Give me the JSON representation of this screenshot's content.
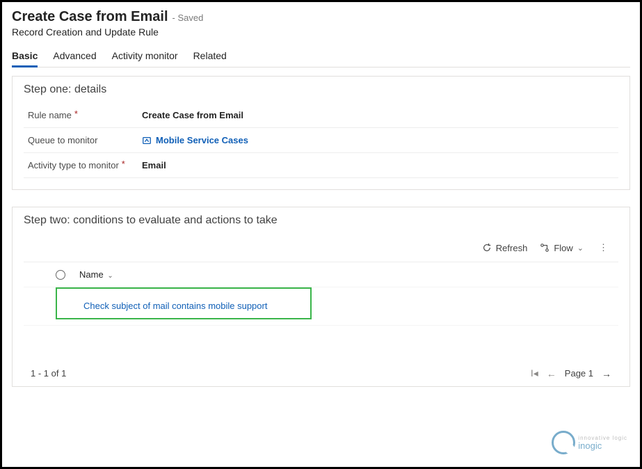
{
  "header": {
    "title": "Create Case from Email",
    "status": "- Saved",
    "subtitle": "Record Creation and Update Rule"
  },
  "tabs": [
    {
      "label": "Basic",
      "active": true
    },
    {
      "label": "Advanced",
      "active": false
    },
    {
      "label": "Activity monitor",
      "active": false
    },
    {
      "label": "Related",
      "active": false
    }
  ],
  "step_one": {
    "heading": "Step one: details",
    "fields": {
      "rule_name": {
        "label": "Rule name",
        "required": true,
        "value": "Create Case from Email"
      },
      "queue": {
        "label": "Queue to monitor",
        "required": false,
        "value": "Mobile Service Cases"
      },
      "activity_type": {
        "label": "Activity type to monitor",
        "required": true,
        "value": "Email"
      }
    }
  },
  "step_two": {
    "heading": "Step two: conditions to evaluate and actions to take",
    "toolbar": {
      "refresh": "Refresh",
      "flow": "Flow"
    },
    "grid": {
      "column": "Name",
      "rows": [
        {
          "name": "Check subject of mail contains mobile support"
        }
      ],
      "count_text": "1 - 1 of 1",
      "page_text": "Page 1"
    }
  },
  "watermark": {
    "brand": "inogic",
    "tag": "innovative logic"
  }
}
